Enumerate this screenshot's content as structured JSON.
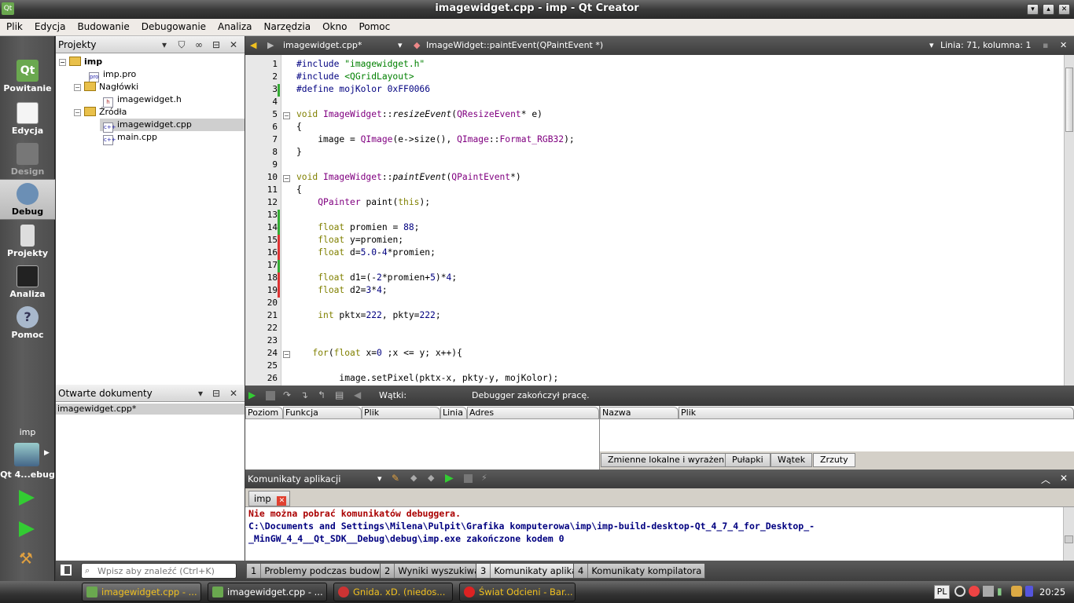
{
  "window": {
    "title": "imagewidget.cpp - imp - Qt Creator",
    "app_icon": "Qt"
  },
  "menu": [
    "Plik",
    "Edycja",
    "Budowanie",
    "Debugowanie",
    "Analiza",
    "Narzędzia",
    "Okno",
    "Pomoc"
  ],
  "modes": [
    {
      "label": "Powitanie",
      "icon": "qt-logo-icon"
    },
    {
      "label": "Edycja",
      "icon": "edit-document-icon"
    },
    {
      "label": "Design",
      "icon": "design-tools-icon"
    },
    {
      "label": "Debug",
      "icon": "debug-bug-icon"
    },
    {
      "label": "Projekty",
      "icon": "projects-icon"
    },
    {
      "label": "Analiza",
      "icon": "analyze-icon"
    },
    {
      "label": "Pomoc",
      "icon": "help-icon"
    }
  ],
  "kit": {
    "project": "imp",
    "name": "Qt 4...ebug"
  },
  "projects_pane": {
    "title": "Projekty",
    "tree": {
      "root": "imp",
      "pro_file": "imp.pro",
      "headers_folder": "Nagłówki",
      "header_file": "imagewidget.h",
      "sources_folder": "Źródła",
      "source_1": "imagewidget.cpp",
      "source_2": "main.cpp"
    }
  },
  "open_docs": {
    "title": "Otwarte dokumenty",
    "items": [
      "imagewidget.cpp*"
    ]
  },
  "editor": {
    "file": "imagewidget.cpp*",
    "function": "ImageWidget::paintEvent(QPaintEvent *)",
    "position": "Linia: 71, kolumna: 1",
    "line_numbers": [
      "1",
      "2",
      "3",
      "4",
      "5",
      "6",
      "7",
      "8",
      "9",
      "10",
      "11",
      "12",
      "13",
      "14",
      "15",
      "16",
      "17",
      "18",
      "19",
      "20",
      "21",
      "22",
      "23",
      "24",
      "25",
      "26"
    ],
    "l1a": "#include ",
    "l1b": "\"imagewidget.h\"",
    "l2a": "#include ",
    "l2b": "<QGridLayout>",
    "l3": "#define mojKolor 0xFF0066",
    "l5a": "void ",
    "l5b": "ImageWidget",
    "l5c": "::",
    "l5d": "resizeEvent",
    "l5e": "(",
    "l5f": "QResizeEvent",
    "l5g": "* e)",
    "l6": "{",
    "l7a": "    image = ",
    "l7b": "QImage",
    "l7c": "(e->size(), ",
    "l7d": "QImage",
    "l7e": "::",
    "l7f": "Format_RGB32",
    "l7g": ");",
    "l8": "}",
    "l10a": "void ",
    "l10b": "ImageWidget",
    "l10c": "::",
    "l10d": "paintEvent",
    "l10e": "(",
    "l10f": "QPaintEvent",
    "l10g": "*)",
    "l11": "{",
    "l12a": "    ",
    "l12b": "QPainter",
    "l12c": " paint(",
    "l12d": "this",
    "l12e": ");",
    "l14a": "    ",
    "l14b": "float",
    "l14c": " promien = ",
    "l14d": "88",
    "l14e": ";",
    "l15a": "    ",
    "l15b": "float",
    "l15c": " y=promien;",
    "l16a": "    ",
    "l16b": "float",
    "l16c": " d=",
    "l16d": "5.0",
    "l16e": "-",
    "l16f": "4",
    "l16g": "*promien;",
    "l18a": "    ",
    "l18b": "float",
    "l18c": " d1=(-",
    "l18d": "2",
    "l18e": "*promien+",
    "l18f": "5",
    "l18g": ")*",
    "l18h": "4",
    "l18i": ";",
    "l19a": "    ",
    "l19b": "float",
    "l19c": " d2=",
    "l19d": "3",
    "l19e": "*",
    "l19f": "4",
    "l19g": ";",
    "l21a": "    ",
    "l21b": "int",
    "l21c": " pktx=",
    "l21d": "222",
    "l21e": ", pkty=",
    "l21f": "222",
    "l21g": ";",
    "l24a": "   ",
    "l24b": "for",
    "l24c": "(",
    "l24d": "float",
    "l24e": " x=",
    "l24f": "0",
    "l24g": " ;x <= y; x++){",
    "l26a": "        image.setPixel(pktx-x, pkty-y, mojKolor);"
  },
  "debugger": {
    "threads_label": "Wątki:",
    "status": "Debugger zakończył pracę.",
    "stack_columns": [
      "Poziom",
      "Funkcja",
      "Plik",
      "Linia",
      "Adres"
    ],
    "locals_columns": [
      "Nazwa",
      "Plik"
    ],
    "tabs": [
      "Zmienne lokalne i wyrażenia",
      "Pułapki",
      "Wątek",
      "Zrzuty"
    ]
  },
  "output": {
    "title": "Komunikaty aplikacji",
    "tab": "imp",
    "lines": [
      "Nie można pobrać komunikatów debuggera.",
      "C:\\Documents and Settings\\Milena\\Pulpit\\Grafika komputerowa\\imp\\imp-build-desktop-Qt_4_7_4_for_Desktop_-",
      "_MinGW_4_4__Qt_SDK__Debug\\debug\\imp.exe zakończone kodem 0"
    ]
  },
  "status": {
    "search_placeholder": "Wpisz aby znaleźć (Ctrl+K)",
    "tabs": [
      {
        "n": "1",
        "label": "Problemy podczas budowania"
      },
      {
        "n": "2",
        "label": "Wyniki wyszukiwań"
      },
      {
        "n": "3",
        "label": "Komunikaty aplikacji"
      },
      {
        "n": "4",
        "label": "Komunikaty kompilatora"
      }
    ]
  },
  "taskbar": {
    "items": [
      "imagewidget.cpp - ...",
      "imagewidget.cpp - ...",
      "Gnida. xD. (niedos...",
      "Świat Odcieni - Bar..."
    ],
    "lang": "PL",
    "clock": "20:25"
  },
  "colors": {
    "keyword": "#808000",
    "type": "#800080",
    "string": "#008000",
    "number": "#000080",
    "error_text": "#aa0000",
    "path_text": "#000080"
  }
}
